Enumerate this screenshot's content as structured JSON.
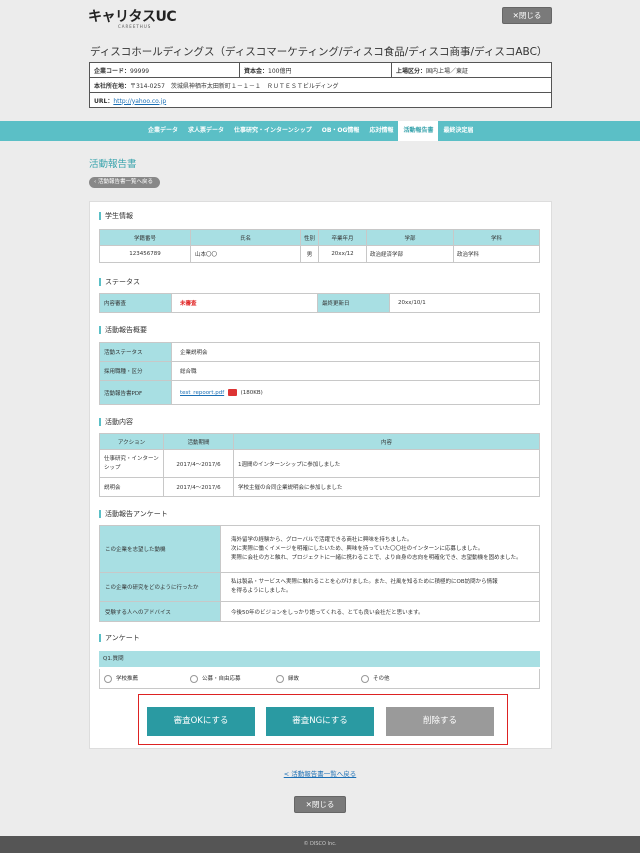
{
  "header": {
    "logo": "キャリタスUC",
    "logo_sub": "CAREETHUS",
    "close_label": "✕閉じる"
  },
  "company": {
    "name": "ディスコホールディングス（ディスコマーケティング/ディスコ食品/ディスコ商事/ディスコABC）",
    "code_label": "企業コード：",
    "code": "99999",
    "capital_label": "資本金：",
    "capital": "100億円",
    "listing_label": "上場区分：",
    "listing": "国内上場／東証",
    "address_label": "本社所在地：",
    "address": "〒314-0257　茨城県神栖市太田新町１－１－１　ＲＵＴＥＳＴビルディング",
    "url_label": "URL：",
    "url": "http://yahoo.co.jp"
  },
  "nav": {
    "items": [
      "企業データ",
      "求人票データ",
      "仕事研究・インターンシップ",
      "OB・OG情報",
      "応対情報",
      "活動報告書",
      "最終決定届"
    ]
  },
  "page": {
    "title": "活動報告書",
    "back_label": "活動報告書一覧へ戻る"
  },
  "student": {
    "heading": "学生情報",
    "headers": [
      "学籍番号",
      "氏名",
      "性別",
      "卒業年月",
      "学部",
      "学科"
    ],
    "row": [
      "123456789",
      "山本〇〇",
      "男",
      "20xx/12",
      "政治経済学部",
      "政治学科"
    ]
  },
  "status": {
    "heading": "ステータス",
    "review_label": "内容審査",
    "review_value": "未審査",
    "updated_label": "最終更新日",
    "updated_value": "20xx/10/1"
  },
  "summary": {
    "heading": "活動報告概要",
    "rows": [
      {
        "label": "活動ステータス",
        "value": "企業説明会"
      },
      {
        "label": "採用職種・区分",
        "value": "総合職"
      }
    ],
    "pdf_label": "活動報告書PDF",
    "pdf_link": "test_repoort.pdf",
    "pdf_size": "(180KB)"
  },
  "activities": {
    "heading": "活動内容",
    "headers": [
      "アクション",
      "活動期間",
      "内容"
    ],
    "rows": [
      {
        "action": "仕事研究・インターンシップ",
        "period": "2017/4～2017/6",
        "content": "1週間のインターンシップに参加しました"
      },
      {
        "action": "説明会",
        "period": "2017/4～2017/6",
        "content": "学校主催の合同企業説明会に参加しました"
      }
    ]
  },
  "questionnaire": {
    "heading": "活動報告アンケート",
    "rows": [
      {
        "q": "この企業を志望した動機",
        "a1": "海外留学の経験から、グローバルで活躍できる商社に興味を持ちました。",
        "a2": "次に実際に働くイメージを明確にしたいため、興味を持っていた〇〇社のインターンに応募しました。",
        "a3": "実際に会社の方と触れ、プロジェクトに一緒に携わることで、より自身の志向を明確化でき、志望動機を固めました。"
      },
      {
        "q": "この企業の研究をどのように行ったか",
        "a1": "私は製品・サービスへ実際に触れることを心がけました。また、社風を知るために積極的にOB訪問から情報",
        "a2": "を得るようにしました。",
        "a3": ""
      },
      {
        "q": "受験する人へのアドバイス",
        "a1": "今後50年のビジョンをしっかり語ってくれる、とても良い会社だと思います。",
        "a2": "",
        "a3": ""
      }
    ]
  },
  "survey": {
    "heading": "アンケート",
    "question": "Q1.質問",
    "options": [
      "学校推薦",
      "公募・自由応募",
      "縁故",
      "その他"
    ]
  },
  "actions": {
    "approve": "審査OKにする",
    "reject": "審査NGにする",
    "delete": "削除する"
  },
  "bottom": {
    "back_link": "< 活動報告書一覧へ戻る",
    "close_label": "✕閉じる"
  },
  "footer": {
    "copyright": "© DISCO Inc."
  }
}
